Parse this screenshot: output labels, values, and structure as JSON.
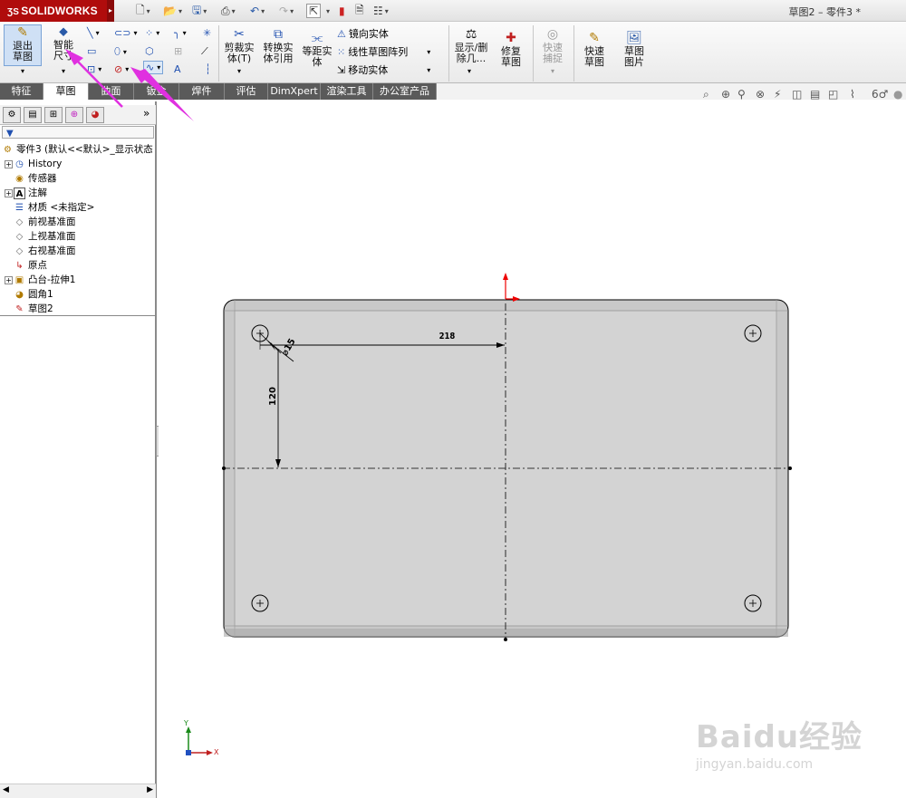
{
  "titlebar": {
    "app_name": "SOLIDWORKS",
    "document_title": "草图2 – 零件3 *"
  },
  "ribbon": {
    "exit_sketch": "退出草图",
    "smart_dimension": "智能尺寸",
    "trim_entities": "剪裁实体(T)",
    "convert_entities": "转换实体引用",
    "offset_entities": "等距实体",
    "mirror_entities": "镜向实体",
    "linear_pattern": "线性草图阵列",
    "move_entities": "移动实体",
    "display_delete_relations": "显示/删除几...",
    "repair_sketch": "修复草图",
    "quick_snaps": "快速捕捉",
    "rapid_sketch": "快速草图",
    "sketch_picture": "草图图片"
  },
  "tabs": [
    {
      "label": "特征"
    },
    {
      "label": "草图"
    },
    {
      "label": "曲面"
    },
    {
      "label": "钣金"
    },
    {
      "label": "焊件"
    },
    {
      "label": "评估"
    },
    {
      "label": "DimXpert"
    },
    {
      "label": "渲染工具"
    },
    {
      "label": "办公室产品"
    }
  ],
  "tree": {
    "root": "零件3  (默认<<默认>_显示状态",
    "items": [
      {
        "label": "History"
      },
      {
        "label": "传感器"
      },
      {
        "label": "注解"
      },
      {
        "label": "材质 <未指定>"
      },
      {
        "label": "前视基准面"
      },
      {
        "label": "上视基准面"
      },
      {
        "label": "右视基准面"
      },
      {
        "label": "原点"
      },
      {
        "label": "凸台-拉伸1"
      },
      {
        "label": "圆角1"
      },
      {
        "label": "草图2"
      }
    ]
  },
  "sketch": {
    "dim_horizontal": "218",
    "dim_vertical": "120",
    "dim_diameter": "15",
    "axis_x": "X",
    "axis_y": "Y"
  },
  "colors": {
    "accent_red": "#b00c0c",
    "annotation_magenta": "#e030e0",
    "panel_face": "#d3d3d3"
  },
  "watermark": {
    "brand": "Baidu经验",
    "url": "jingyan.baidu.com"
  }
}
